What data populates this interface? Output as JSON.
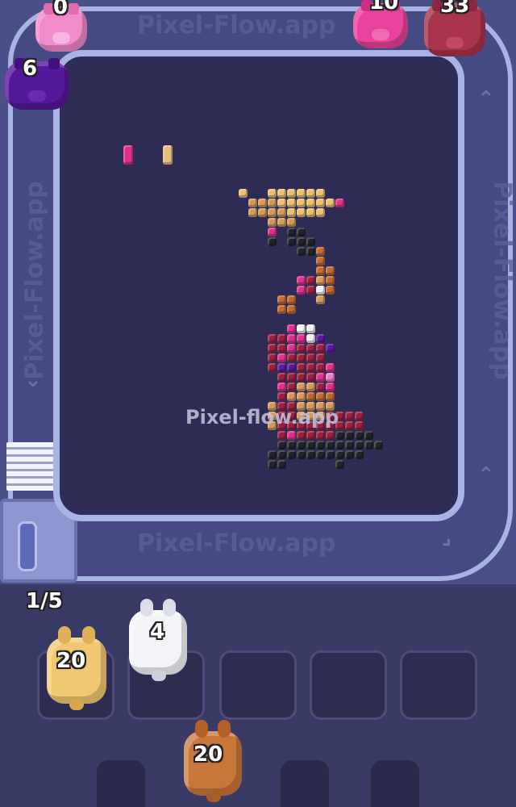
{
  "watermark": "Pixel-flow.app",
  "track_watermark": "Pixel-Flow.app",
  "progress": {
    "label": "1/5",
    "done": 1,
    "total": 5
  },
  "conveyor_pigs": [
    {
      "name": "pink-pig-top-left",
      "count": "0",
      "color": "#f27fc7"
    },
    {
      "name": "purple-pig-left",
      "count": "6",
      "color": "#55189a"
    },
    {
      "name": "magenta-pig-top",
      "count": "10",
      "color": "#e8449c"
    },
    {
      "name": "maroon-pig-top-right",
      "count": "33",
      "color": "#a8344e"
    }
  ],
  "shooters": [
    {
      "name": "gold-shooter",
      "count": "20",
      "color": "#f0c872"
    },
    {
      "name": "white-shooter",
      "count": "4",
      "color": "#f3f4f7"
    },
    {
      "name": "brown-shooter-queued",
      "count": "20",
      "color": "#c8773a"
    }
  ],
  "slots": 5,
  "palette": {
    "gold": "#e8c070",
    "tan": "#d49a5a",
    "brown": "#c06a30",
    "magenta": "#e0318a",
    "pink": "#f080c8",
    "maroon": "#9a2040",
    "purple": "#5a1aa0",
    "black": "#23232e",
    "white": "#f2f2f6",
    "red": "#d0384c"
  }
}
